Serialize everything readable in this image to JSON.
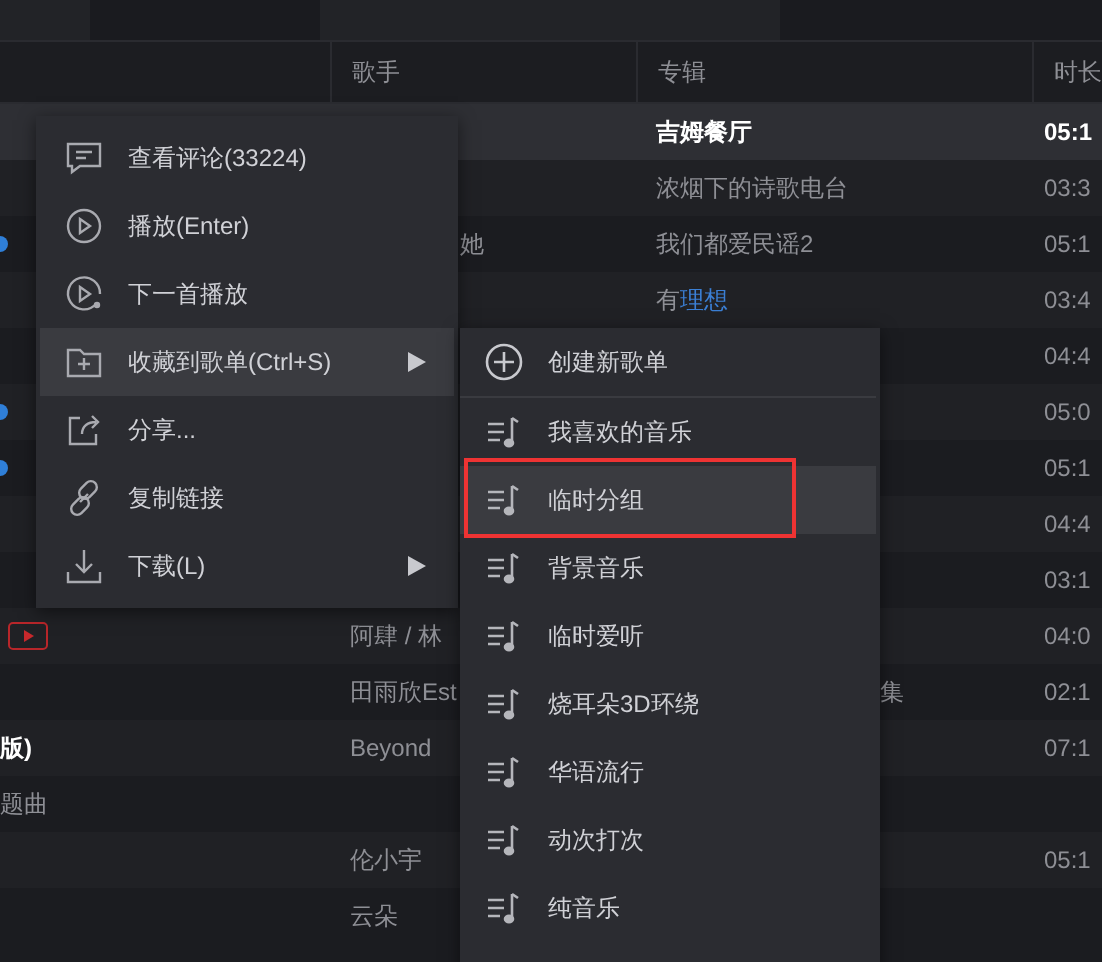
{
  "table": {
    "columns": [
      "歌手",
      "专辑",
      "时长"
    ],
    "rows": [
      {
        "selected": true,
        "title": "",
        "singer": "",
        "album": "吉姆餐厅",
        "album_link": "",
        "duration": "05:1"
      },
      {
        "selected": false,
        "title": "",
        "singer": "",
        "album": "浓烟下的诗歌电台",
        "album_link": "",
        "duration": "03:3"
      },
      {
        "selected": false,
        "badge": {
          "kind": "status"
        },
        "title": "",
        "singer": "她",
        "album": "我们都爱民谣2",
        "album_link": "",
        "duration": "05:1"
      },
      {
        "selected": false,
        "title": "",
        "singer": "",
        "album": "有",
        "album_link": "理想",
        "duration": "03:4"
      },
      {
        "selected": false,
        "title": "",
        "singer": "",
        "album": "",
        "album_link": "",
        "duration": "04:4"
      },
      {
        "selected": false,
        "badge": {
          "kind": "status"
        },
        "title": "",
        "singer": "",
        "album": "",
        "album_link": "",
        "duration": "05:0"
      },
      {
        "selected": false,
        "badge": {
          "kind": "status"
        },
        "title": "",
        "singer": "",
        "album": "",
        "album_link": "",
        "duration": "05:1"
      },
      {
        "selected": false,
        "title": "",
        "singer": "",
        "album": "",
        "album_link": "",
        "duration": "04:4"
      },
      {
        "selected": false,
        "title": "",
        "singer": "",
        "album": "",
        "album_link": "",
        "duration": "03:1"
      },
      {
        "selected": false,
        "badge": {
          "kind": "video"
        },
        "title": "",
        "singer": "阿肆 / 林",
        "album": "",
        "album_link": "",
        "duration": "04:0"
      },
      {
        "selected": false,
        "title": "",
        "singer": "田雨欣Est",
        "album": "集",
        "album_link": "",
        "duration": "02:1"
      },
      {
        "selected": false,
        "playing": true,
        "title": "版)",
        "singer": "Beyond",
        "album": "",
        "album_link": "",
        "duration": "07:1"
      },
      {
        "selected": false,
        "title": "题曲",
        "singer": "",
        "album": "",
        "album_link": "",
        "duration": ""
      },
      {
        "selected": false,
        "title": "",
        "singer": "伦小宇",
        "album": "",
        "album_link": "",
        "duration": "05:1"
      },
      {
        "selected": false,
        "title": "",
        "singer": "云朵",
        "album": "",
        "album_link": "",
        "duration": ""
      }
    ]
  },
  "context_menu": {
    "items": [
      {
        "label": "查看评论(33224)",
        "selected": false,
        "submenu": false
      },
      {
        "label": "播放(Enter)",
        "selected": false,
        "submenu": false
      },
      {
        "label": "下一首播放",
        "selected": false,
        "submenu": false
      },
      {
        "label": "收藏到歌单(Ctrl+S)",
        "selected": true,
        "submenu": true
      },
      {
        "label": "分享...",
        "selected": false,
        "submenu": false
      },
      {
        "label": "复制链接",
        "selected": false,
        "submenu": false
      },
      {
        "label": "下载(L)",
        "selected": false,
        "submenu": true
      }
    ]
  },
  "submenu": {
    "items": [
      {
        "kind": "create",
        "label": "创建新歌单",
        "selected": false,
        "outlined": false
      },
      {
        "kind": "playlist",
        "label": "我喜欢的音乐",
        "selected": false,
        "outlined": false
      },
      {
        "kind": "playlist",
        "label": "临时分组",
        "selected": true,
        "outlined": true
      },
      {
        "kind": "playlist",
        "label": "背景音乐",
        "selected": false,
        "outlined": false
      },
      {
        "kind": "playlist",
        "label": "临时爱听",
        "selected": false,
        "outlined": false
      },
      {
        "kind": "playlist",
        "label": "烧耳朵3D环绕",
        "selected": false,
        "outlined": false
      },
      {
        "kind": "playlist",
        "label": "华语流行",
        "selected": false,
        "outlined": false
      },
      {
        "kind": "playlist",
        "label": "动次打次",
        "selected": false,
        "outlined": false
      },
      {
        "kind": "playlist",
        "label": "纯音乐",
        "selected": false,
        "outlined": false
      }
    ]
  }
}
